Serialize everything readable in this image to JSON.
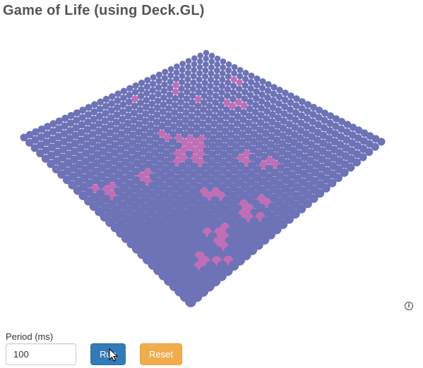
{
  "page": {
    "title": "Game of Life (using Deck.GL)"
  },
  "board": {
    "grid_size": 32,
    "colors": {
      "dead": "#6e72b6",
      "alive": "#bf6fb6"
    },
    "alive_rows": [
      "00000000000000000000000000000000",
      "00000000000000000000000000000000",
      "00000001100000000000000000000000",
      "00000000000000000000000000000000",
      "00000000000000000000000000000000",
      "00000000000110000000000000000000",
      "00000000001100000000000000000000",
      "00000000000000000000000000000000",
      "00010001000000000000000000000000",
      "00001000000000000000000000000000",
      "00000000000000000000001100000000",
      "00000000000000000001001000000000",
      "00000000000000000001100000000000",
      "00000000000001000000000000000000",
      "00100000000011100000000000000000",
      "00000000000111110000000000110000",
      "00000000011001011000000000000000",
      "00000000000001100000000001101000",
      "00000000000000100000011000110000",
      "00000000000000000000110000000000",
      "00000000000000000000000000000000",
      "00000000000000000000000000100000",
      "00000000000001000000000000110000",
      "00000000000001100000000001011000",
      "00000000000000000000000000000010",
      "00000000000000000000000000000100",
      "00000000000000000000000000011000",
      "00000000000010000000000000001000",
      "00000000000011000000000000000000",
      "00000000000100000000000000000000",
      "00000000000000000000000000000000",
      "00000000000000000000000000000000"
    ]
  },
  "controls": {
    "period_label": "Period (ms)",
    "period_value": "100",
    "run_label": "Run",
    "reset_label": "Reset"
  },
  "overlay": {
    "info_icon": "info-icon",
    "info_glyph": "i",
    "cursor_icon": "pointer-cursor-icon"
  }
}
